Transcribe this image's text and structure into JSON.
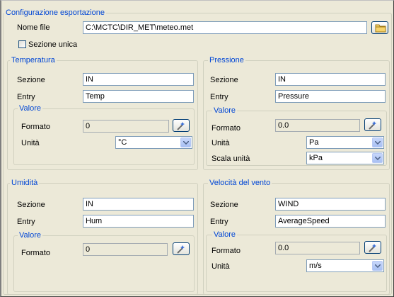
{
  "config": {
    "title": "Configurazione esportazione",
    "file_label": "Nome file",
    "file_value": "C:\\MCTC\\DIR_MET\\meteo.met",
    "single_section_label": "Sezione unica",
    "single_section_checked": false
  },
  "temperature": {
    "title": "Temperatura",
    "section_label": "Sezione",
    "section_value": "IN",
    "entry_label": "Entry",
    "entry_value": "Temp",
    "value_title": "Valore",
    "format_label": "Formato",
    "format_value": "0",
    "unit_label": "Unità",
    "unit_value": "°C"
  },
  "pressure": {
    "title": "Pressione",
    "section_label": "Sezione",
    "section_value": "IN",
    "entry_label": "Entry",
    "entry_value": "Pressure",
    "value_title": "Valore",
    "format_label": "Formato",
    "format_value": "0.0",
    "unit_label": "Unità",
    "unit_value": "Pa",
    "scale_label": "Scala unità",
    "scale_value": "kPa"
  },
  "humidity": {
    "title": "Umidità",
    "section_label": "Sezione",
    "section_value": "IN",
    "entry_label": "Entry",
    "entry_value": "Hum",
    "value_title": "Valore",
    "format_label": "Formato",
    "format_value": "0"
  },
  "wind": {
    "title": "Velocità del vento",
    "section_label": "Sezione",
    "section_value": "WIND",
    "entry_label": "Entry",
    "entry_value": "AverageSpeed",
    "value_title": "Valore",
    "format_label": "Formato",
    "format_value": "0.0",
    "unit_label": "Unità",
    "unit_value": "m/s"
  },
  "icons": {
    "browse": "folder-icon",
    "format_edit": "wand-icon",
    "dropdown": "chevron-down-icon"
  },
  "colors": {
    "group_title": "#0046d5",
    "background": "#ece9d8",
    "field_border": "#7f9db9"
  }
}
